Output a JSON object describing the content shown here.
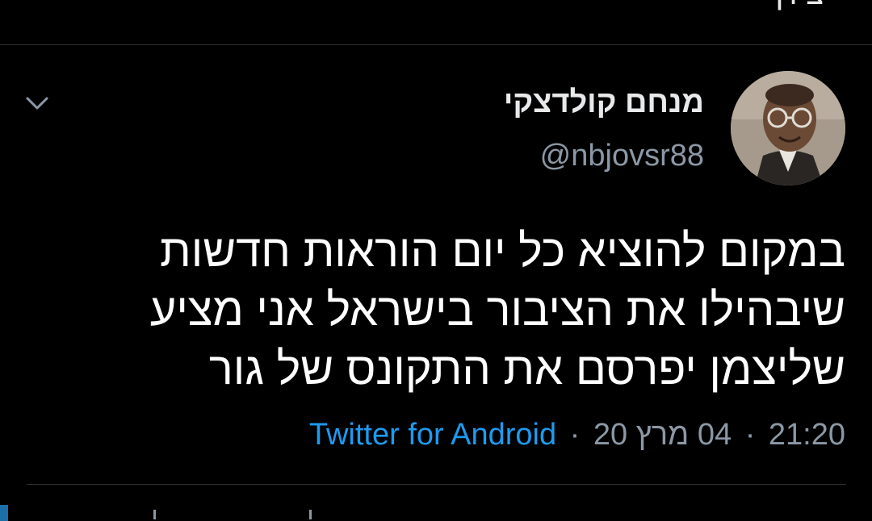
{
  "header": {
    "partial_title": "ציוץ"
  },
  "tweet": {
    "display_name": "מנחם קולדצקי",
    "handle": "@nbjovsr88",
    "text_lines": [
      "במקום להוציא כל יום הוראות חדשות",
      "שיבהילו את הציבור בישראל אני מציע",
      "שליצמן יפרסם את התקונס של גור"
    ],
    "time": "21:20",
    "date": "04 מרץ 20",
    "separator": "·",
    "source": "Twitter for Android"
  },
  "icons": {
    "menu": "chevron-down-icon",
    "avatar": "avatar-photo"
  },
  "colors": {
    "background": "#000000",
    "primary_text": "#e7e9ea",
    "secondary_text": "#8b98a5",
    "link": "#1d9bf0",
    "divider": "#2f3336"
  }
}
